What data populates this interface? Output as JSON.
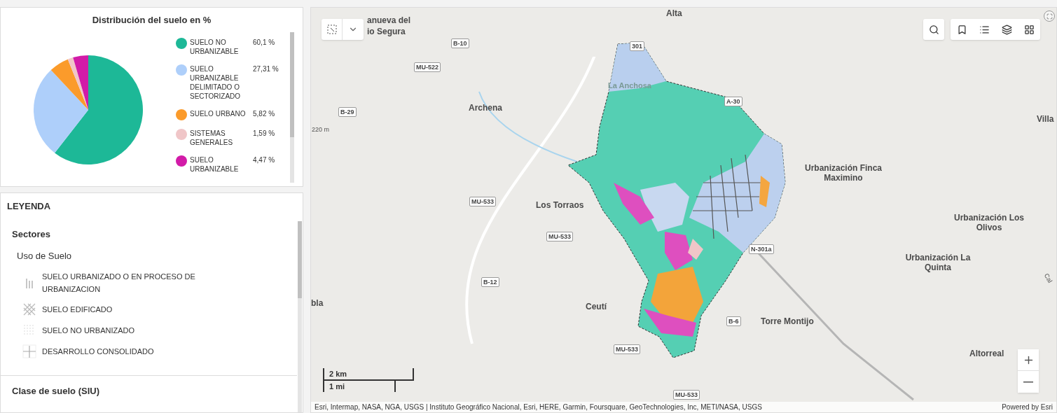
{
  "chart_card": {
    "chart_data": {
      "type": "pie",
      "title": "Distribución del suelo en %",
      "categories": [
        "SUELO NO URBANIZABLE",
        "SUELO URBANIZABLE DELIMITADO O SECTORIZADO",
        "SUELO URBANO",
        "SISTEMAS GENERALES",
        "SUELO URBANIZABLE"
      ],
      "values": [
        60.1,
        27.31,
        5.82,
        1.59,
        4.47
      ]
    },
    "legend": [
      {
        "value": "60,1 %",
        "color": "#1db897"
      },
      {
        "value": "27,31 %",
        "color": "#aecffa"
      },
      {
        "value": "5,82 %",
        "color": "#fb9b2b"
      },
      {
        "value": "1,59 %",
        "color": "#f0c6c8"
      },
      {
        "value": "4,47 %",
        "color": "#d21ba8"
      }
    ]
  },
  "legend_panel": {
    "title": "LEYENDA",
    "layer": "Sectores",
    "group": "Uso de Suelo",
    "items": [
      {
        "kind": "lines",
        "label": "SUELO URBANIZADO O EN PROCESO DE URBANIZACION"
      },
      {
        "kind": "crosshatch",
        "label": "SUELO EDIFICADO"
      },
      {
        "kind": "dots",
        "label": "SUELO NO URBANIZADO"
      },
      {
        "kind": "cross",
        "label": "DESARROLLO CONSOLIDADO"
      }
    ],
    "next_layer": "Clase de suelo (SIU)"
  },
  "map": {
    "labels": [
      {
        "kind": "place",
        "text": "anueva del"
      },
      {
        "kind": "place",
        "text": "io Segura"
      },
      {
        "kind": "place",
        "text": "Alta"
      },
      {
        "kind": "faded",
        "text": "La Anchosa"
      },
      {
        "kind": "place",
        "text": "Archena"
      },
      {
        "kind": "small",
        "text": "220 m"
      },
      {
        "kind": "place",
        "text": "Los Torraos"
      },
      {
        "kind": "place",
        "text": "Villa"
      },
      {
        "kind": "place",
        "text": "Urbanización Finca Maximino"
      },
      {
        "kind": "place",
        "text": "Urbanización Los Olivos"
      },
      {
        "kind": "place",
        "text": "Urbanización La Quinta"
      },
      {
        "kind": "place",
        "text": "bla"
      },
      {
        "kind": "place",
        "text": "Ceutí"
      },
      {
        "kind": "place",
        "text": "Torre Montijo"
      },
      {
        "kind": "place",
        "text": "Altorreal"
      },
      {
        "kind": "small",
        "text": "Cal"
      },
      {
        "kind": "road",
        "text": "B-10"
      },
      {
        "kind": "road",
        "text": "MU-522"
      },
      {
        "kind": "road",
        "text": "301"
      },
      {
        "kind": "road",
        "text": "B-29"
      },
      {
        "kind": "road",
        "text": "A-30"
      },
      {
        "kind": "road",
        "text": "MU-533"
      },
      {
        "kind": "road",
        "text": "MU-533"
      },
      {
        "kind": "road",
        "text": "B-12"
      },
      {
        "kind": "road",
        "text": "N-301a"
      },
      {
        "kind": "road",
        "text": "B-6"
      },
      {
        "kind": "road",
        "text": "MU-533"
      },
      {
        "kind": "road",
        "text": "MU-533"
      }
    ],
    "scale": [
      "2 km",
      "1 mi"
    ],
    "attribution": "Esri, Intermap, NASA, NGA, USGS | Instituto Geográfico Nacional, Esri, HERE, Garmin, Foursquare, GeoTechnologies, Inc, METI/NASA, USGS",
    "powered_by": "Powered by Esri"
  }
}
